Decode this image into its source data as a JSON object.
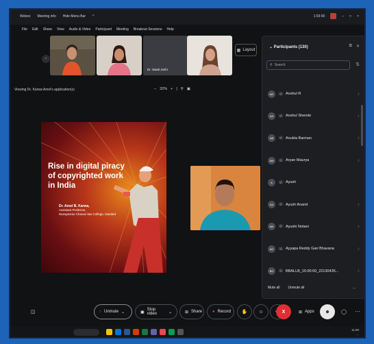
{
  "titlebar": {
    "items": [
      "Webex",
      "Meeting info",
      "Hide Menu Bar",
      "^"
    ],
    "time": "1:03:00",
    "controls": [
      "–",
      "□",
      "×"
    ]
  },
  "menu": [
    "File",
    "Edit",
    "Share",
    "View",
    "Audio & Video",
    "Participant",
    "Meeting",
    "Breakout Sessions",
    "Help"
  ],
  "strip": {
    "tiles": [
      {
        "name": ""
      },
      {
        "name": ""
      },
      {
        "name": "Dr. Swati Joshi"
      },
      {
        "name": ""
      }
    ],
    "layout_label": "Layout"
  },
  "share": {
    "label": "Viewing Dr. Karwa Amol's application(s)",
    "zoom": "32%",
    "zoom_minus": "–",
    "zoom_plus": "+"
  },
  "slide": {
    "title": "Rise in digital piracy of copyrighted work in India",
    "author_name": "Dr. Amol B. Karwa,",
    "author_role": "Assistant Professor,",
    "author_college": "Narayanrao Chavan law College, Nanded"
  },
  "participants": {
    "title": "Participants (130)",
    "search_placeholder": "Search",
    "list": [
      {
        "initials": "AR",
        "name": "Anshul R"
      },
      {
        "initials": "AS",
        "name": "Anshul Shende"
      },
      {
        "initials": "AB",
        "name": "Anukta Barman"
      },
      {
        "initials": "AM",
        "name": "Aryan Maurya"
      },
      {
        "initials": "A",
        "name": "Ayush"
      },
      {
        "initials": "AA",
        "name": "Ayush Anand"
      },
      {
        "initials": "AN",
        "name": "Ayushi Notani"
      },
      {
        "initials": "AG",
        "name": "Ayyapa Reddy Gari Bhavana"
      },
      {
        "initials": "BG",
        "name": "BBALLB_15:00:00_22130435..."
      }
    ],
    "mute_all": "Mute all",
    "unmute_all": "Unmute all",
    "more": "..."
  },
  "toolbar": {
    "unmute": "Unmute",
    "stop_video": "Stop video",
    "share": "Share",
    "record": "Record",
    "end": "X",
    "apps": "Apps"
  },
  "taskbar": {
    "time": "11:00",
    "date": "..."
  },
  "colors": {
    "accent": "#1d63b8",
    "end_call": "#e02f34",
    "muted": "#d2413f"
  }
}
